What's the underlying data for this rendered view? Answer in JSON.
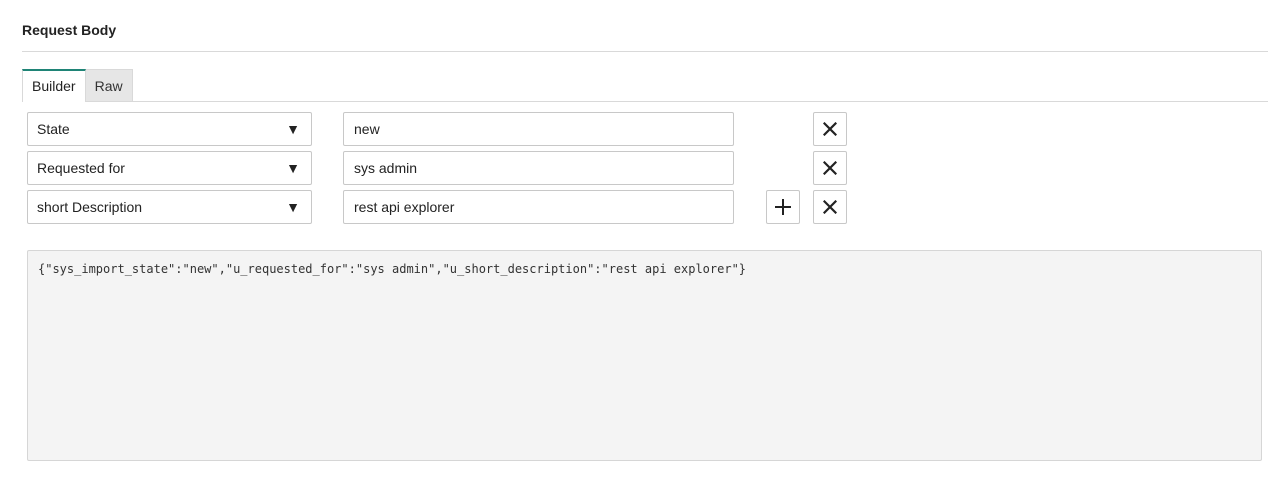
{
  "section": {
    "title": "Request Body"
  },
  "tabs": [
    {
      "label": "Builder",
      "active": true
    },
    {
      "label": "Raw",
      "active": false
    }
  ],
  "rows": [
    {
      "field": "State",
      "value": "new"
    },
    {
      "field": "Requested for",
      "value": "sys admin"
    },
    {
      "field": "short Description",
      "value": "rest api explorer"
    }
  ],
  "icons": {
    "caret": "▼",
    "add": "plus-icon",
    "remove": "close-icon"
  },
  "output": {
    "json": "{\"sys_import_state\":\"new\",\"u_requested_for\":\"sys admin\",\"u_short_description\":\"rest api explorer\"}"
  },
  "colors": {
    "active_tab_accent": "#1f8476",
    "output_bg": "#f4f4f4"
  }
}
